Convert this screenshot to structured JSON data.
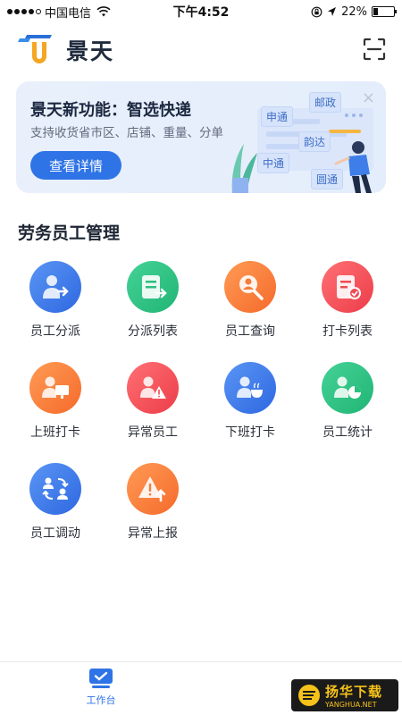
{
  "status_bar": {
    "carrier": "中国电信",
    "time": "下午4:52",
    "battery": "22%",
    "battery_level": 0.22
  },
  "header": {
    "app_name": "景天",
    "scan_icon": "scan-icon"
  },
  "banner": {
    "title": "景天新功能：智选快递",
    "subtitle": "支持收货省市区、店铺、重量、分单",
    "button": "查看详情",
    "close": "×",
    "tags": [
      "邮政",
      "申通",
      "韵达",
      "中通",
      "圆通"
    ]
  },
  "section": {
    "title": "劳务员工管理",
    "items": [
      {
        "label": "员工分派",
        "icon": "employee-assign-icon",
        "color": "blue"
      },
      {
        "label": "分派列表",
        "icon": "assign-list-icon",
        "color": "green"
      },
      {
        "label": "员工查询",
        "icon": "employee-search-icon",
        "color": "orange"
      },
      {
        "label": "打卡列表",
        "icon": "clock-in-list-icon",
        "color": "red"
      },
      {
        "label": "上班打卡",
        "icon": "clock-in-icon",
        "color": "orange"
      },
      {
        "label": "异常员工",
        "icon": "abnormal-employee-icon",
        "color": "red"
      },
      {
        "label": "下班打卡",
        "icon": "clock-out-icon",
        "color": "blue"
      },
      {
        "label": "员工统计",
        "icon": "employee-stats-icon",
        "color": "green"
      },
      {
        "label": "员工调动",
        "icon": "employee-transfer-icon",
        "color": "blue"
      },
      {
        "label": "异常上报",
        "icon": "abnormal-report-icon",
        "color": "orange"
      }
    ]
  },
  "tabbar": {
    "tabs": [
      {
        "label": "工作台",
        "icon": "workbench-icon",
        "active": true
      }
    ]
  },
  "watermark": {
    "main": "扬华下载",
    "sub": "YANGHUA.NET"
  }
}
